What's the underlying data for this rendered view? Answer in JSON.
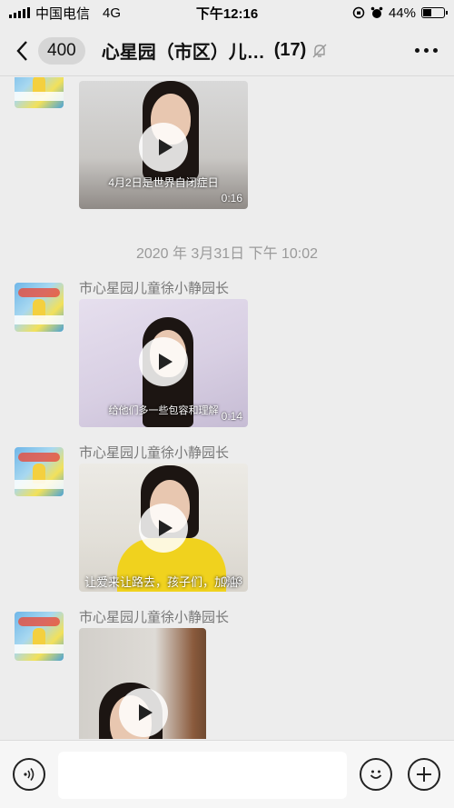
{
  "status_bar": {
    "carrier": "中国电信",
    "network": "4G",
    "time": "下午12:16",
    "battery": "44%",
    "battery_level": 0.44
  },
  "nav": {
    "back_count": "400",
    "title": "心星园（市区）儿…",
    "member_count": "(17)"
  },
  "messages": {
    "video1": {
      "caption": "4月2日是世界自闭症日",
      "duration": "0:16"
    },
    "timestamp": "2020 年 3月31日 下午 10:02",
    "msg2": {
      "sender": "市心星园儿童徐小静园长",
      "caption": "给他们多一些包容和理解",
      "duration": "0:14"
    },
    "msg3": {
      "sender": "市心星园儿童徐小静园长",
      "caption": "让爱来让路去，孩子们，加油!",
      "duration": "0:13"
    },
    "msg4": {
      "sender": "市心星园儿童徐小静园长"
    }
  },
  "input_bar": {
    "placeholder": ""
  },
  "colors": {
    "background": "#ededed",
    "sender_gray": "#777777",
    "timestamp_gray": "#9a9a9a"
  }
}
